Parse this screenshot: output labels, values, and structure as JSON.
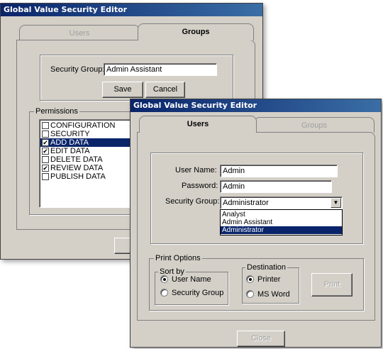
{
  "back_window": {
    "title": "Global Value Security Editor",
    "tabs": [
      {
        "label": "Users",
        "active": false
      },
      {
        "label": "Groups",
        "active": true
      }
    ],
    "security_group_label": "Security Group:",
    "security_group_value": "Admin Assistant",
    "save_label": "Save",
    "cancel_label": "Cancel",
    "permissions_legend": "Permissions",
    "permissions": [
      {
        "label": "CONFIGURATION",
        "checked": false,
        "selected": false
      },
      {
        "label": "SECURITY",
        "checked": false,
        "selected": false
      },
      {
        "label": "ADD DATA",
        "checked": true,
        "selected": true
      },
      {
        "label": "EDIT DATA",
        "checked": true,
        "selected": false
      },
      {
        "label": "DELETE DATA",
        "checked": false,
        "selected": false
      },
      {
        "label": "REVIEW DATA",
        "checked": true,
        "selected": false
      },
      {
        "label": "PUBLISH DATA",
        "checked": false,
        "selected": false
      }
    ]
  },
  "front_window": {
    "title": "Global Value Security Editor",
    "tabs": [
      {
        "label": "Users",
        "active": true
      },
      {
        "label": "Groups",
        "active": false
      }
    ],
    "user_name_label": "User Name:",
    "user_name_value": "Admin",
    "password_label": "Password:",
    "password_value": "Admin",
    "security_group_label": "Security Group:",
    "security_group_value": "Administrator",
    "security_group_options": [
      {
        "label": "Analyst",
        "selected": false
      },
      {
        "label": "Admin Assistant",
        "selected": false
      },
      {
        "label": "Administrator",
        "selected": true
      }
    ],
    "print_options_legend": "Print Options",
    "sort_by_legend": "Sort by",
    "sort_by_options": [
      {
        "label": "User Name",
        "selected": true
      },
      {
        "label": "Security Group",
        "selected": false
      }
    ],
    "destination_legend": "Destination",
    "destination_options": [
      {
        "label": "Printer",
        "selected": true
      },
      {
        "label": "MS Word",
        "selected": false
      }
    ],
    "print_label": "Print",
    "close_label": "Close"
  },
  "icons": {
    "checkmark": "✔",
    "combo_arrow": "▼"
  }
}
